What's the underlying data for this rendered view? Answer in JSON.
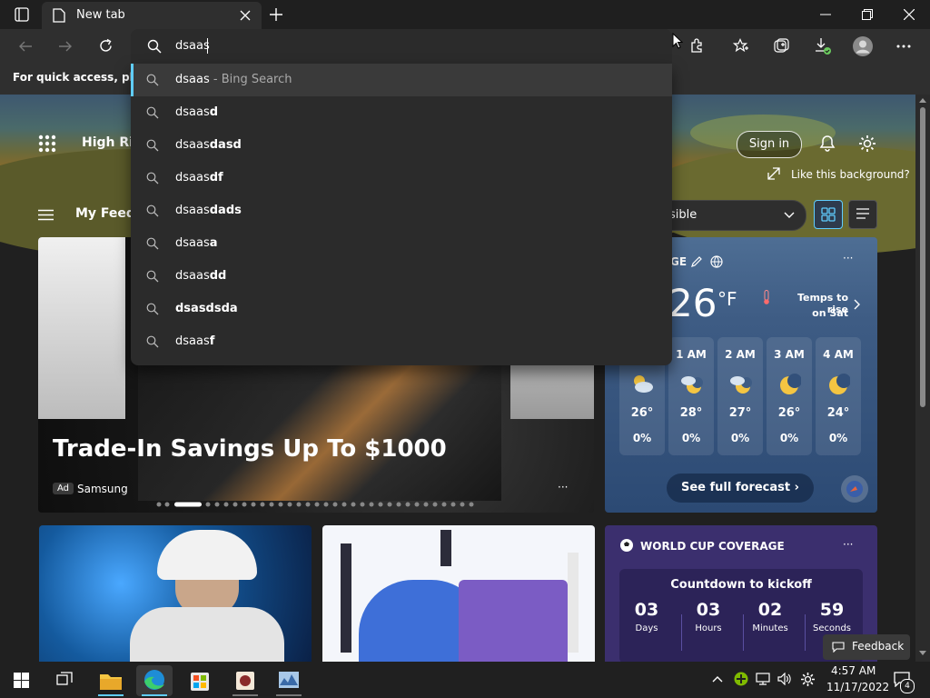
{
  "tab": {
    "title": "New tab"
  },
  "omnibox": {
    "value": "dsaas"
  },
  "favorites_bar": {
    "text": "For quick access, place y"
  },
  "suggestions": [
    {
      "prefix": "dsaas",
      "bold": "",
      "suffix": " - Bing Search"
    },
    {
      "prefix": "dsaas",
      "bold": "d",
      "suffix": ""
    },
    {
      "prefix": "dsaas",
      "bold": "dasd",
      "suffix": ""
    },
    {
      "prefix": "dsaas",
      "bold": "df",
      "suffix": ""
    },
    {
      "prefix": "dsaas",
      "bold": "dads",
      "suffix": ""
    },
    {
      "prefix": "dsaas",
      "bold": "a",
      "suffix": ""
    },
    {
      "prefix": "dsaas",
      "bold": "dd",
      "suffix": ""
    },
    {
      "prefix": "",
      "bold": "dsasdsda",
      "suffix": ""
    },
    {
      "prefix": "dsaas",
      "bold": "f",
      "suffix": ""
    }
  ],
  "hero": {
    "location": "High Rid",
    "sign_in": "Sign in",
    "like_bg": "Like this background?"
  },
  "feed": {
    "my_feed": "My Feed",
    "layout_select": "sible"
  },
  "ad": {
    "headline": "Trade-In Savings Up To $1000",
    "ad_badge": "Ad",
    "sponsor": "Samsung",
    "more": "···"
  },
  "weather": {
    "loc_partial": "GE",
    "temp": "26",
    "unit": "°F",
    "note_line1": "Temps to rise",
    "note_line2": "on Sat",
    "hours": [
      {
        "time": "",
        "temp": "26°",
        "precip": "0%"
      },
      {
        "time": "1 AM",
        "temp": "28°",
        "precip": "0%"
      },
      {
        "time": "2 AM",
        "temp": "27°",
        "precip": "0%"
      },
      {
        "time": "3 AM",
        "temp": "26°",
        "precip": "0%"
      },
      {
        "time": "4 AM",
        "temp": "24°",
        "precip": "0%"
      }
    ],
    "forecast_btn": "See full forecast ›",
    "more": "···"
  },
  "worldcup": {
    "title": "WORLD CUP COVERAGE",
    "countdown_title": "Countdown to kickoff",
    "units": [
      {
        "n": "03",
        "label": "Days"
      },
      {
        "n": "03",
        "label": "Hours"
      },
      {
        "n": "02",
        "label": "Minutes"
      },
      {
        "n": "59",
        "label": "Seconds"
      }
    ],
    "more": "···"
  },
  "feedback": "Feedback",
  "taskbar": {
    "time": "4:57 AM",
    "date": "11/17/2022",
    "notif_count": "4"
  },
  "colors": {
    "accent": "#60cdff",
    "dropdown_bg": "#2b2b2b",
    "weather_bg": "#3e5c84",
    "worldcup_bg": "#3b2f6e"
  }
}
